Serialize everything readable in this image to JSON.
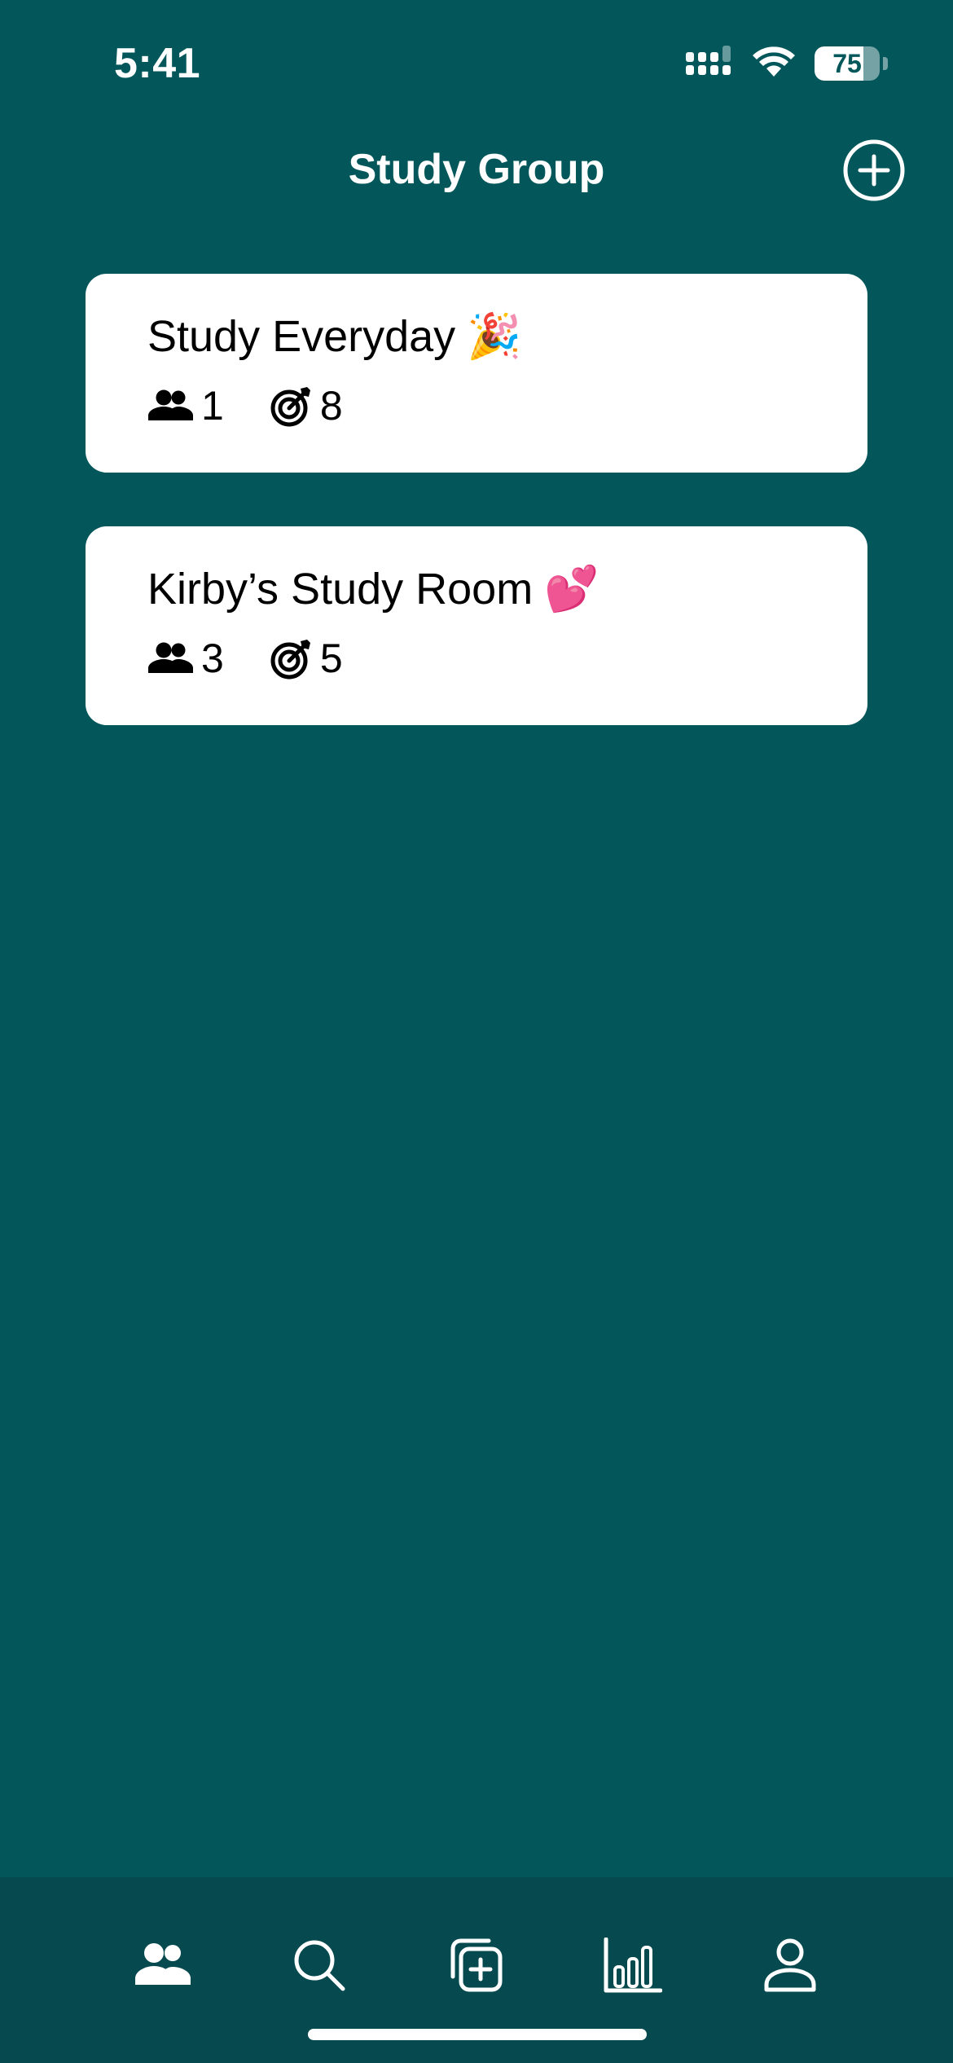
{
  "status_bar": {
    "time": "5:41",
    "battery_level": "75",
    "battery_fraction": 0.75,
    "icons": [
      "cellular-signal-icon",
      "wifi-icon",
      "battery-icon"
    ]
  },
  "header": {
    "title": "Study Group",
    "add_icon": "plus-circle-icon"
  },
  "groups": [
    {
      "name": "Study Everyday",
      "emoji": "🎉",
      "members": "1",
      "goals": "8"
    },
    {
      "name": "Kirby’s Study Room",
      "emoji": "💕",
      "members": "3",
      "goals": "5"
    }
  ],
  "tab_bar": {
    "items": [
      "people-icon",
      "search-icon",
      "add-square-icon",
      "bar-chart-icon",
      "person-icon"
    ],
    "active": "people-icon"
  },
  "colors": {
    "background": "#03575b",
    "tab_bar": "#064a4f",
    "card": "#ffffff",
    "text_on_card": "#000000"
  }
}
